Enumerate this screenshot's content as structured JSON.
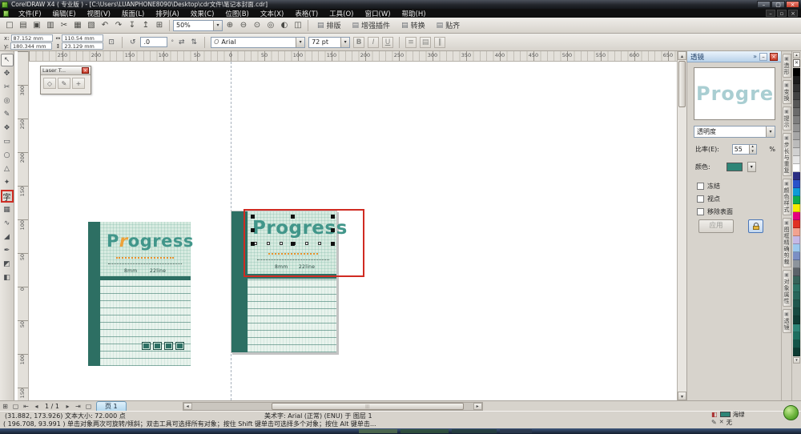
{
  "window": {
    "title": "CorelDRAW X4 ( 专业版 ) - [C:\\Users\\LUANPHONE8090\\Desktop\\cdr文件\\笔记本封面.cdr]",
    "minimize": "–",
    "maximize": "▢",
    "close": "×"
  },
  "glyphs": {
    "dropdown": "▾",
    "spin_up": "▴",
    "spin_down": "▾",
    "up": "▴",
    "down": "▾",
    "left": "◂",
    "right": "▸",
    "first": "⇤",
    "last": "⇥",
    "doc_min": "–",
    "doc_restore": "▫",
    "doc_close": "×",
    "expand": "»",
    "no_color": "✕",
    "grip": "|||",
    "lock_hint": "",
    "degree": "°"
  },
  "menubar": {
    "items": [
      {
        "name": "menu-file",
        "label": "文件(F)"
      },
      {
        "name": "menu-edit",
        "label": "编辑(E)"
      },
      {
        "name": "menu-view",
        "label": "视图(V)"
      },
      {
        "name": "menu-layout",
        "label": "版面(L)"
      },
      {
        "name": "menu-arrange",
        "label": "排列(A)"
      },
      {
        "name": "menu-effects",
        "label": "效果(C)"
      },
      {
        "name": "menu-bitmaps",
        "label": "位图(B)"
      },
      {
        "name": "menu-text",
        "label": "文本(X)"
      },
      {
        "name": "menu-table",
        "label": "表格(T)"
      },
      {
        "name": "menu-tools",
        "label": "工具(O)"
      },
      {
        "name": "menu-window",
        "label": "窗口(W)"
      },
      {
        "name": "menu-help",
        "label": "帮助(H)"
      }
    ]
  },
  "toolbar_std": {
    "icons": [
      {
        "name": "new-document-icon",
        "glyph": "□"
      },
      {
        "name": "open-icon",
        "glyph": "▤"
      },
      {
        "name": "save-icon",
        "glyph": "▣"
      },
      {
        "name": "print-icon",
        "glyph": "▥"
      },
      {
        "name": "cut-icon",
        "glyph": "✂"
      },
      {
        "name": "copy-icon",
        "glyph": "▦"
      },
      {
        "name": "paste-icon",
        "glyph": "▧"
      },
      {
        "name": "undo-icon",
        "glyph": "↶"
      },
      {
        "name": "redo-icon",
        "glyph": "↷"
      },
      {
        "name": "import-icon",
        "glyph": "↧"
      },
      {
        "name": "export-icon",
        "glyph": "↥"
      },
      {
        "name": "app-launcher-icon",
        "glyph": "⊞"
      }
    ],
    "zoom_value": "50%",
    "zoom_icons": [
      {
        "name": "zoom-in-icon",
        "glyph": "⊕"
      },
      {
        "name": "zoom-out-icon",
        "glyph": "⊖"
      },
      {
        "name": "zoom-selected-icon",
        "glyph": "⊙"
      },
      {
        "name": "zoom-all-icon",
        "glyph": "◎"
      },
      {
        "name": "zoom-page-icon",
        "glyph": "◐"
      },
      {
        "name": "zoom-width-icon",
        "glyph": "◫"
      }
    ],
    "buttons": [
      {
        "name": "typeset-button",
        "label": "排版"
      },
      {
        "name": "plugin-button",
        "label": "增强插件"
      },
      {
        "name": "convert-button",
        "label": "转换"
      },
      {
        "name": "snap-button",
        "label": "贴齐"
      }
    ]
  },
  "property_bar": {
    "x_label": "x:",
    "x_value": "87.152 mm",
    "y_label": "y:",
    "y_value": "180.344 mm",
    "w_value": "110.54 mm",
    "h_value": "23.129 mm",
    "lock_glyph": "⊡",
    "angle_value": ".0",
    "angle_glyph": "↺",
    "mirror_h": "⇄",
    "mirror_v": "⇅",
    "font_symbol": "O",
    "font_name": "Arial",
    "font_size": "72 pt",
    "bold": "B",
    "italic": "I",
    "underline": "U",
    "align_icon": "≡",
    "para_icon": "▤",
    "col_icon": "‖"
  },
  "toolbox": {
    "tools": [
      {
        "name": "pick-tool",
        "glyph": "↖",
        "cls": "active"
      },
      {
        "name": "shape-tool",
        "glyph": "✥"
      },
      {
        "name": "crop-tool",
        "glyph": "✂"
      },
      {
        "name": "zoom-tool",
        "glyph": "◎"
      },
      {
        "name": "freehand-tool",
        "glyph": "✎"
      },
      {
        "name": "smart-fill-tool",
        "glyph": "❖"
      },
      {
        "name": "rectangle-tool",
        "glyph": "▭"
      },
      {
        "name": "ellipse-tool",
        "glyph": "○"
      },
      {
        "name": "polygon-tool",
        "glyph": "△"
      },
      {
        "name": "basic-shapes-tool",
        "glyph": "✦"
      },
      {
        "name": "text-tool",
        "glyph": "字",
        "cls": "red-box"
      },
      {
        "name": "table-tool",
        "glyph": "▦"
      },
      {
        "name": "interactive-blend-tool",
        "glyph": "∿"
      },
      {
        "name": "eyedropper-tool",
        "glyph": "◢"
      },
      {
        "name": "outline-pen-tool",
        "glyph": "✒"
      },
      {
        "name": "fill-tool",
        "glyph": "◩"
      },
      {
        "name": "interactive-fill-tool",
        "glyph": "◧"
      }
    ]
  },
  "rulers": {
    "h_numbers": [
      "250",
      "200",
      "150",
      "100",
      "50",
      "0",
      "50",
      "100",
      "150",
      "200",
      "250",
      "300",
      "350",
      "400",
      "450",
      "500",
      "550",
      "600",
      "650"
    ],
    "v_numbers": [
      "300",
      "250",
      "200",
      "150",
      "100",
      "50",
      "0",
      "50",
      "100",
      "150"
    ]
  },
  "laser_toolbar": {
    "title": "Laser T...",
    "close": "×",
    "icons": [
      {
        "name": "laser-node-icon",
        "glyph": "◇"
      },
      {
        "name": "laser-draw-icon",
        "glyph": "✎"
      },
      {
        "name": "laser-add-icon",
        "glyph": "+"
      }
    ]
  },
  "notebooks": {
    "left": {
      "title_head": "P",
      "title_accent": "r",
      "title_tail": "ogress",
      "spec_left": "8mm",
      "spec_right": "22line"
    },
    "right": {
      "title": "Progress",
      "spec_left": "8mm",
      "spec_right": "22line"
    }
  },
  "lens": {
    "title": "透镜",
    "preview": "Progress",
    "mode": "透明度",
    "rate_label": "比率(E):",
    "rate_value": "55",
    "rate_unit": "%",
    "color_label": "颜色:",
    "options": [
      {
        "name": "freeze-checkbox",
        "label": "冻结"
      },
      {
        "name": "viewpoint-checkbox",
        "label": "视点"
      },
      {
        "name": "remove-face-checkbox",
        "label": "移除表面"
      }
    ],
    "apply_label": "应用"
  },
  "docker_tabs": {
    "tabs": [
      {
        "name": "tab-shaping",
        "label": "造形"
      },
      {
        "name": "tab-transform",
        "label": "变换"
      },
      {
        "name": "tab-hints",
        "label": "提示"
      },
      {
        "name": "tab-step-repeat",
        "label": "步长与重复"
      },
      {
        "name": "tab-color-styles",
        "label": "颜色样式"
      },
      {
        "name": "tab-powerclip",
        "label": "图框精确剪裁"
      },
      {
        "name": "tab-properties",
        "label": "对象属性"
      },
      {
        "name": "tab-lens",
        "label": "透镜"
      }
    ]
  },
  "palette": {
    "colors": [
      "#000000",
      "#1c1c1c",
      "#303030",
      "#434343",
      "#575757",
      "#6b6b6b",
      "#7f7f7f",
      "#939393",
      "#a7a7a7",
      "#bbbbbb",
      "#d0d0d0",
      "#e6e6e6",
      "#ffffff",
      "#2b2e83",
      "#2a52c9",
      "#0f9bd7",
      "#0faa4e",
      "#f5ec00",
      "#e5007e",
      "#e03123",
      "#f2a28f",
      "#c5b8e6",
      "#9dc8ee",
      "#7b8fc4",
      "#8d949c",
      "#5c6269",
      "#37635a",
      "#2e7366",
      "#27655a",
      "#1f574d",
      "#174a41",
      "#0f3d35",
      "#2e8577",
      "#1d6f5f",
      "#145448",
      "#0c3a31"
    ]
  },
  "pagebar": {
    "add_icon": "⊞",
    "doc_icon": "▢",
    "nav_text": "1 / 1",
    "tab_label": "页 1"
  },
  "status": {
    "line1_left": "(31.882, 173.926) 文本大小: 72.000 点",
    "line1_mid": "美术字: Arial (正常) (ENU) 于 图层 1",
    "fill_name": "海绿",
    "outline_none": "无",
    "line2": "( 196.708, 93.991 ) 单击对象两次可旋转/倾斜；双击工具可选择所有对象；按住 Shift 键单击可选择多个对象；按住 Alt 键单击..."
  },
  "colors": {
    "accent_teal": "#2e8577",
    "spine_teal": "#2d6f63",
    "annotation_red": "#d02b22"
  }
}
